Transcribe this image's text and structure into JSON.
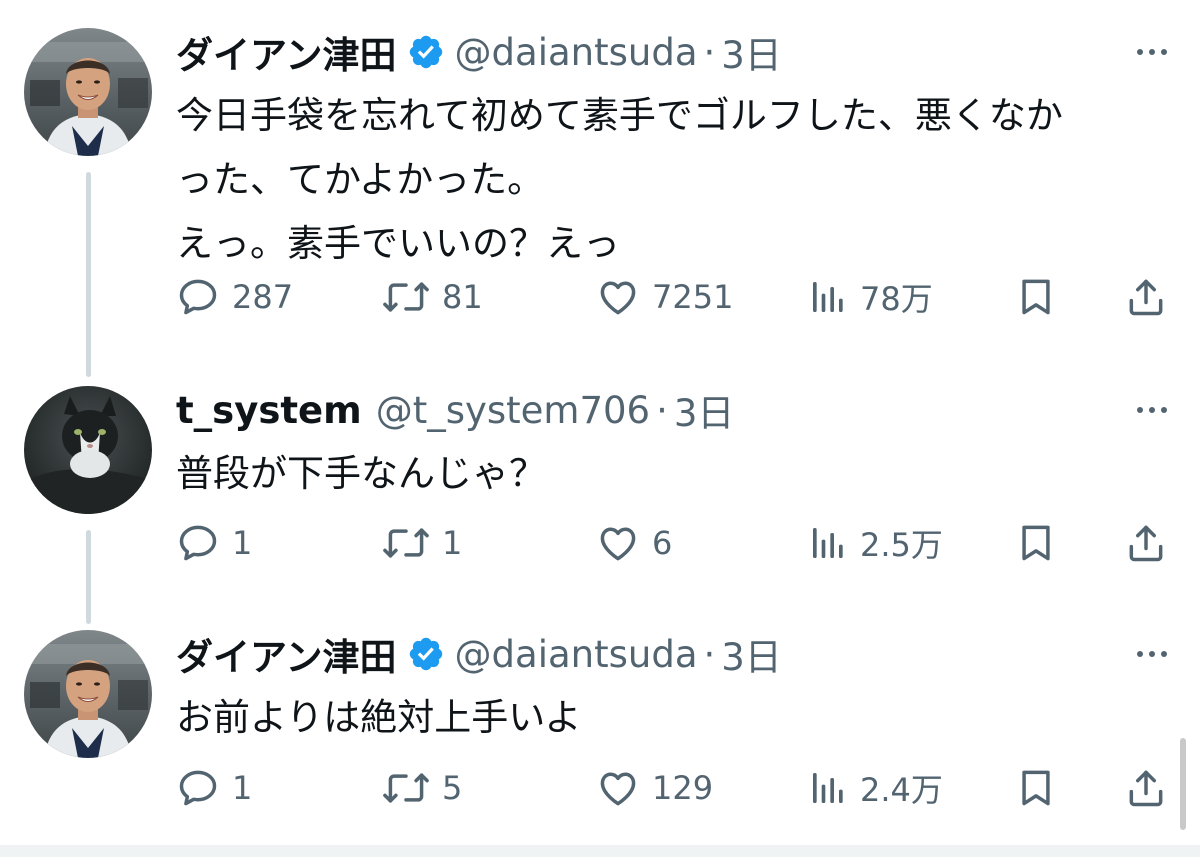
{
  "tweets": [
    {
      "author_name": "ダイアン津田",
      "verified": true,
      "handle": "@daiantsuda",
      "separator": "·",
      "time": "3日",
      "text_lines": [
        "今日手袋を忘れて初めて素手でゴルフした、悪くなか",
        "った、てかよかった。",
        "えっ。素手でいいの？えっ"
      ],
      "reply_count": "287",
      "retweet_count": "81",
      "like_count": "7251",
      "view_count": "78万",
      "avatar": "person-avatar"
    },
    {
      "author_name": "t_system",
      "verified": false,
      "handle": "@t_system706",
      "separator": "·",
      "time": "3日",
      "text_lines": [
        "普段が下手なんじゃ？"
      ],
      "reply_count": "1",
      "retweet_count": "1",
      "like_count": "6",
      "view_count": "2.5万",
      "avatar": "cat-avatar"
    },
    {
      "author_name": "ダイアン津田",
      "verified": true,
      "handle": "@daiantsuda",
      "separator": "·",
      "time": "3日",
      "text_lines": [
        "お前よりは絶対上手いよ"
      ],
      "reply_count": "1",
      "retweet_count": "5",
      "like_count": "129",
      "view_count": "2.4万",
      "avatar": "person-avatar"
    }
  ],
  "colors": {
    "text": "#0f1419",
    "secondary": "#536471",
    "verified": "#1d9bf0",
    "thread_line": "#cfd9de"
  }
}
